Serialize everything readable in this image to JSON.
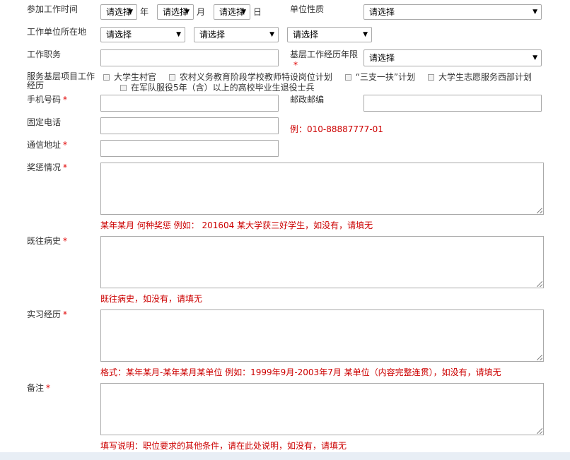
{
  "work_start": {
    "label": "参加工作时间",
    "year": "请选择",
    "year_unit": "年",
    "month": "请选择",
    "month_unit": "月",
    "day": "请选择",
    "day_unit": "日"
  },
  "unit_nature": {
    "label": "单位性质",
    "value": "请选择"
  },
  "work_location": {
    "label": "工作单位所在地",
    "province": "请选择",
    "city": "请选择",
    "district": "请选择"
  },
  "job_title": {
    "label": "工作职务",
    "value": ""
  },
  "grassroots_years": {
    "label": "基层工作经历年限",
    "value": "请选择"
  },
  "grassroots_project": {
    "label": "服务基层项目工作经历",
    "options": [
      "大学生村官",
      "农村义务教育阶段学校教师特设岗位计划",
      "“三支一扶”计划",
      "大学生志愿服务西部计划",
      "在军队服役5年（含）以上的高校毕业生退役士兵"
    ]
  },
  "mobile": {
    "label": "手机号码",
    "value": ""
  },
  "postcode": {
    "label": "邮政邮编",
    "value": ""
  },
  "landline": {
    "label": "固定电话",
    "value": "",
    "hint": "例：010-88887777-01"
  },
  "address": {
    "label": "通信地址",
    "value": ""
  },
  "awards": {
    "label": "奖惩情况",
    "value": "",
    "hint": "某年某月 何种奖惩 例如： 201604 某大学获三好学生，如没有，请填无"
  },
  "medical_history": {
    "label": "既往病史",
    "value": "",
    "hint": "既往病史，如没有，请填无"
  },
  "internship": {
    "label": "实习经历",
    "value": "",
    "hint": "格式：某年某月-某年某月某单位 例如：1999年9月-2003年7月 某单位（内容完整连贯），如没有，请填无"
  },
  "remarks": {
    "label": "备注",
    "value": "",
    "hint": "填写说明：职位要求的其他条件，请在此处说明，如没有，请填无"
  },
  "required_mark": "*",
  "dropdown_icon": "triangle-down"
}
